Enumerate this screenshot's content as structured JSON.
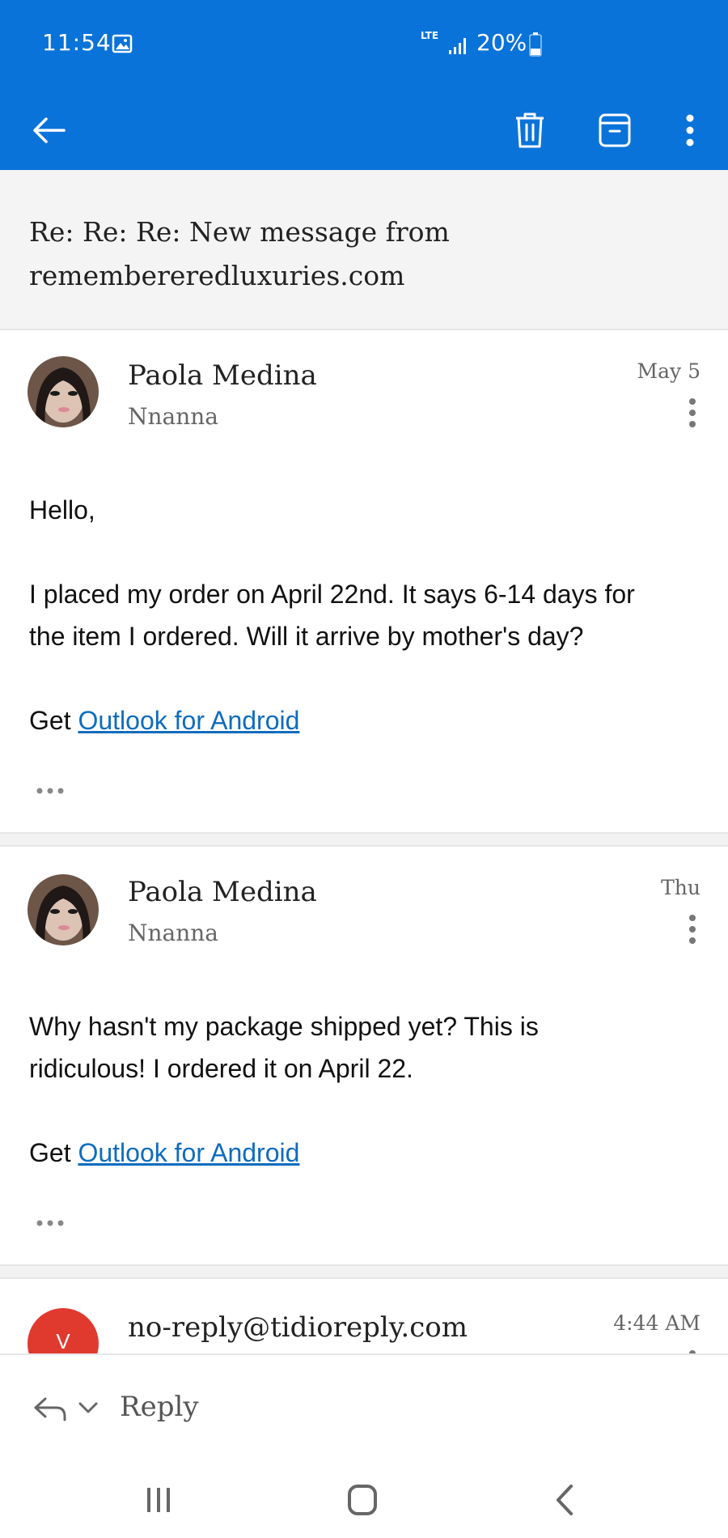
{
  "status_bar": {
    "time": "11:54",
    "network": "LTE",
    "battery": "20%"
  },
  "subject": "Re: Re: Re: New message from remembereredluxuries.com",
  "messages": [
    {
      "sender": "Paola Medina",
      "subline": "Nnanna",
      "date": "May 5",
      "body": [
        "Hello,",
        "I placed my order on April 22nd. It says 6-14 days for",
        "the item I ordered. Will it arrive by mother's day?"
      ],
      "get_prefix": "Get",
      "link_text": "Outlook for Android"
    },
    {
      "sender": "Paola Medina",
      "subline": "Nnanna",
      "date": "Thu",
      "body": [
        "Why hasn't my package shipped yet? This is",
        "ridiculous! I ordered it on April 22."
      ],
      "get_prefix": "Get",
      "link_text": "Outlook for Android"
    },
    {
      "sender": "no-reply@tidioreply.com",
      "avatar_letter": "V",
      "date": "4:44 AM"
    }
  ],
  "reply_bar": {
    "label": "Reply"
  },
  "colors": {
    "header": "#0a73d9",
    "link": "#0f6cbd",
    "avatar_red": "#e03a2f"
  }
}
